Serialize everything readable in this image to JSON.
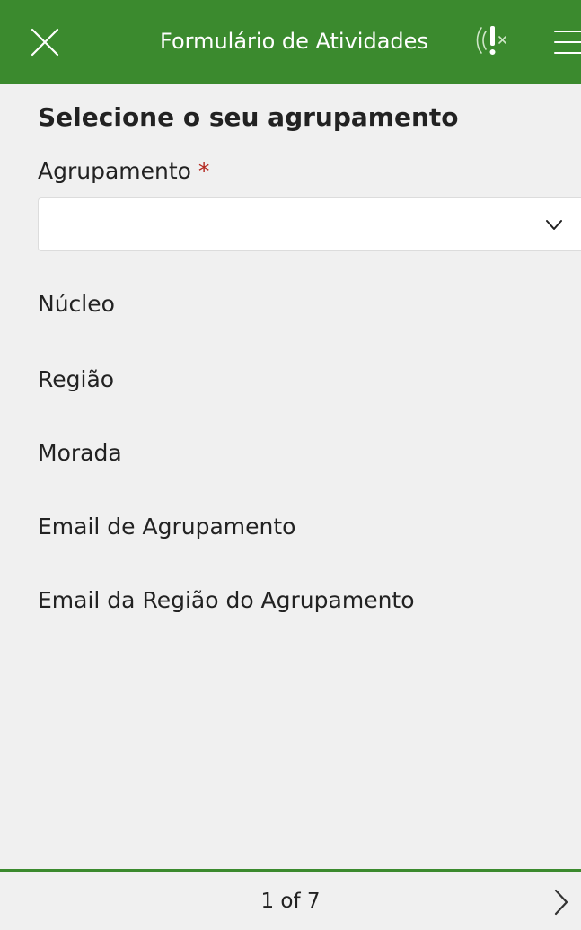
{
  "header": {
    "title": "Formulário de Atividades",
    "close_icon": "close-icon",
    "gps_icon": "gps-location-icon",
    "menu_icon": "hamburger-menu-icon",
    "background_color": "#3b8a2e"
  },
  "form": {
    "page_title": "Selecione o seu agrupamento",
    "field_label": "Agrupamento",
    "required_mark": "*",
    "select": {
      "value": "",
      "chevron_icon": "chevron-down-icon"
    },
    "fields": [
      {
        "label": "Núcleo"
      },
      {
        "label": "Região"
      },
      {
        "label": "Morada"
      },
      {
        "label": "Email de Agrupamento"
      },
      {
        "label": "Email da Região do Agrupamento"
      }
    ]
  },
  "footer": {
    "page_indicator": "1 of 7",
    "next_icon": "chevron-right-icon",
    "accent_color": "#3b8a2e"
  }
}
